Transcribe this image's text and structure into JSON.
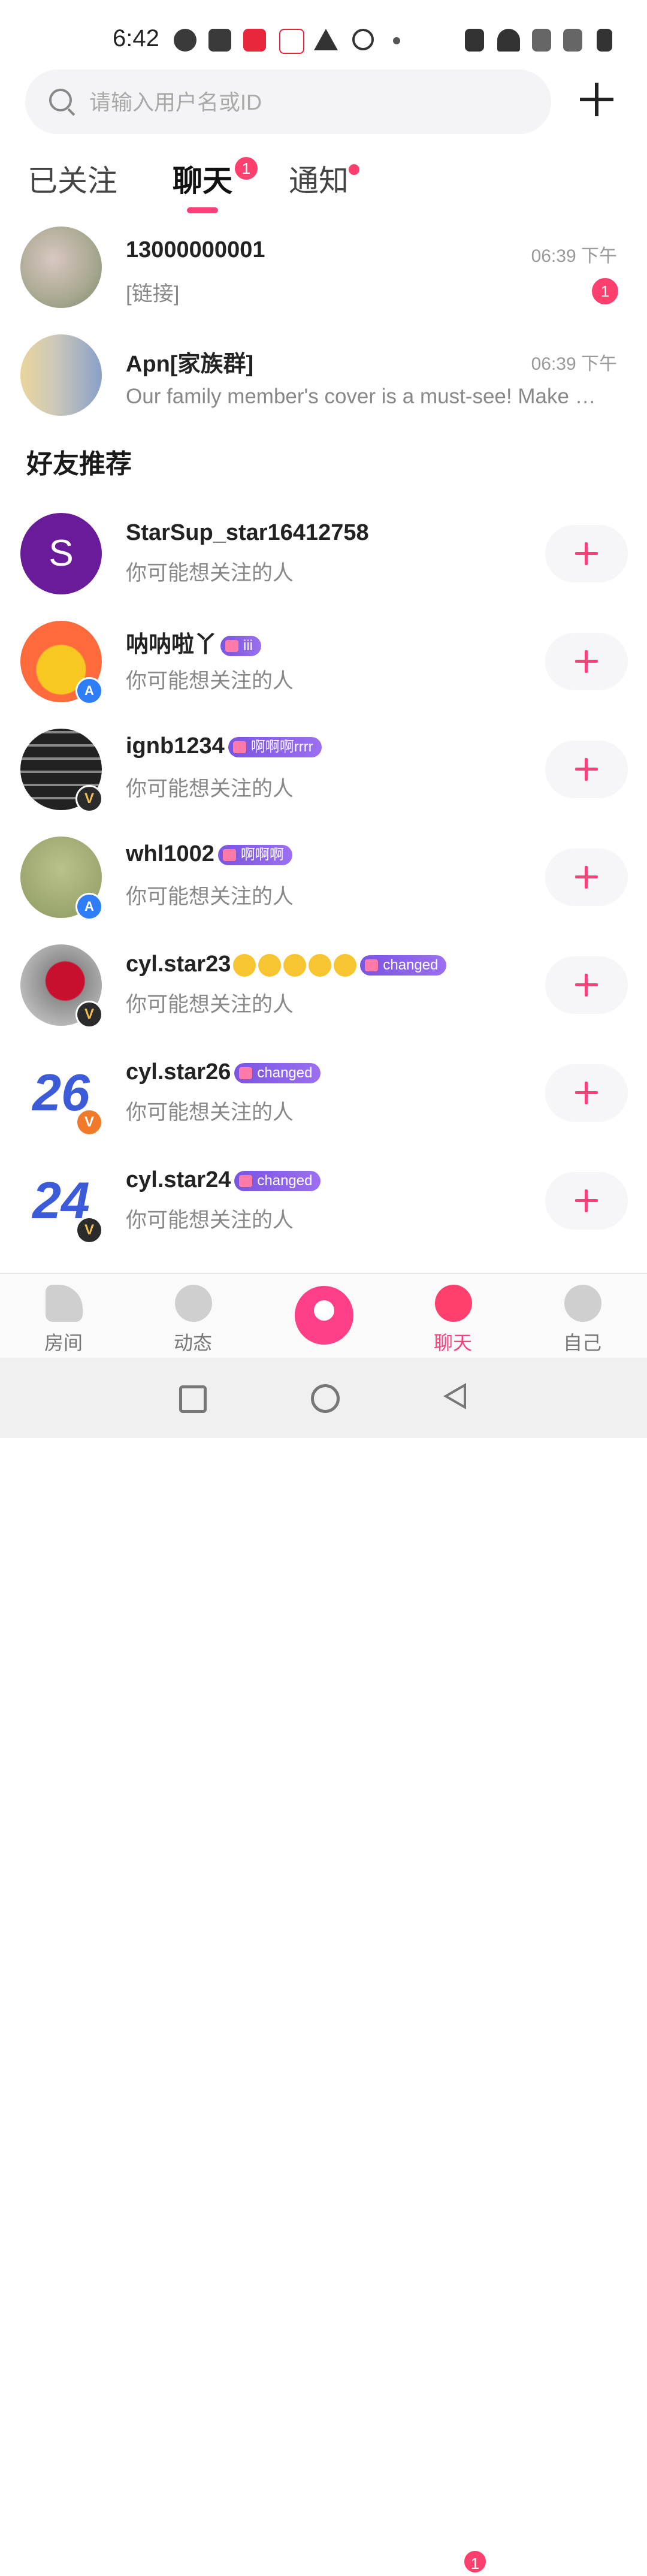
{
  "status_bar": {
    "time": "6:42"
  },
  "search": {
    "placeholder": "请输入用户名或ID"
  },
  "tabs": [
    {
      "label": "已关注"
    },
    {
      "label": "聊天",
      "badge": "1"
    },
    {
      "label": "通知"
    }
  ],
  "chats": [
    {
      "name": "13000000001",
      "preview": "[链接]",
      "time": "06:39 下午",
      "unread": "1"
    },
    {
      "name": "Apn[家族群]",
      "preview": "Our family member's cover is a must-see! Make …",
      "time": "06:39 下午"
    }
  ],
  "recommend": {
    "title": "好友推荐",
    "subtitle": "你可能想关注的人",
    "users": [
      {
        "name": "StarSup_star16412758",
        "initial": "S"
      },
      {
        "name": "呐呐啦丫",
        "tag": "iii"
      },
      {
        "name": "ignb1234",
        "tag": "啊啊啊rrrr"
      },
      {
        "name": "whl1002",
        "tag": "啊啊啊"
      },
      {
        "name": "cyl.star23",
        "tag": "changed"
      },
      {
        "name": "cyl.star26",
        "tag": "changed"
      },
      {
        "name": "cyl.star24",
        "tag": "changed"
      }
    ]
  },
  "bottom_nav": [
    {
      "label": "房间"
    },
    {
      "label": "动态"
    },
    {
      "label": "聊天",
      "badge": "1"
    },
    {
      "label": "自己"
    }
  ],
  "colors": {
    "accent": "#ff3f7a",
    "tag": "#8a63e8"
  }
}
